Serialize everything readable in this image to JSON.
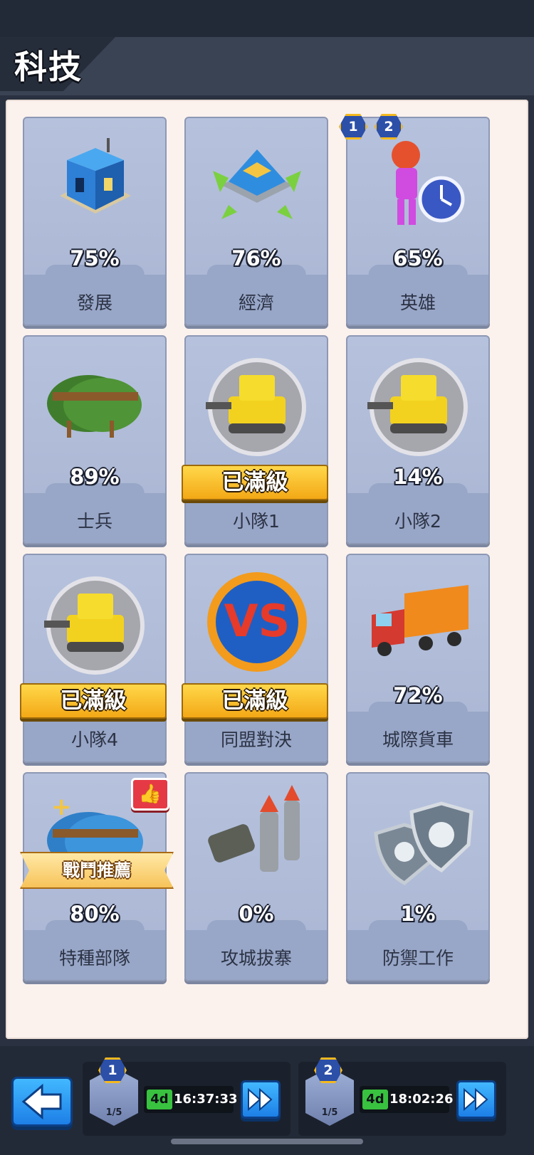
{
  "header": {
    "title": "科技"
  },
  "cards": [
    {
      "name": "發展",
      "percent": "75%",
      "maxed": false,
      "icon": "building-icon"
    },
    {
      "name": "經濟",
      "percent": "76%",
      "maxed": false,
      "icon": "headquarters-icon"
    },
    {
      "name": "英雄",
      "percent": "65%",
      "maxed": false,
      "icon": "hero-icon",
      "badges": [
        "1",
        "2"
      ]
    },
    {
      "name": "士兵",
      "percent": "89%",
      "maxed": false,
      "icon": "helmet-icon"
    },
    {
      "name": "小隊1",
      "percent": "",
      "maxed": true,
      "maxed_label": "已滿級",
      "icon": "tank-icon"
    },
    {
      "name": "小隊2",
      "percent": "14%",
      "maxed": false,
      "icon": "tank-icon"
    },
    {
      "name": "小隊4",
      "percent": "",
      "maxed": true,
      "maxed_label": "已滿級",
      "icon": "tank-icon"
    },
    {
      "name": "同盟對決",
      "percent": "",
      "maxed": true,
      "maxed_label": "已滿級",
      "icon": "vs-icon"
    },
    {
      "name": "城際貨車",
      "percent": "72%",
      "maxed": false,
      "icon": "truck-icon"
    },
    {
      "name": "特種部隊",
      "percent": "80%",
      "maxed": false,
      "icon": "special-helmet-icon",
      "recommend_label": "戰鬥推薦",
      "liked": true
    },
    {
      "name": "攻城拔寨",
      "percent": "0%",
      "maxed": false,
      "icon": "missile-icon"
    },
    {
      "name": "防禦工作",
      "percent": "1%",
      "maxed": false,
      "icon": "shield-gear-icon"
    }
  ],
  "bottom": {
    "back_icon": "back-arrow-icon",
    "slots": [
      {
        "number": "1",
        "progress": "1/5",
        "days": "4d",
        "time": "16:37:33",
        "skip_icon": "fast-forward-icon"
      },
      {
        "number": "2",
        "progress": "1/5",
        "days": "4d",
        "time": "18:02:26",
        "skip_icon": "fast-forward-icon"
      }
    ]
  },
  "colors": {
    "panel": "#fbf2ee",
    "card": "#b6c2dd",
    "maxed_banner": "#f3a816",
    "timer_green": "#38c23f",
    "button_blue": "#1d7fe6"
  }
}
